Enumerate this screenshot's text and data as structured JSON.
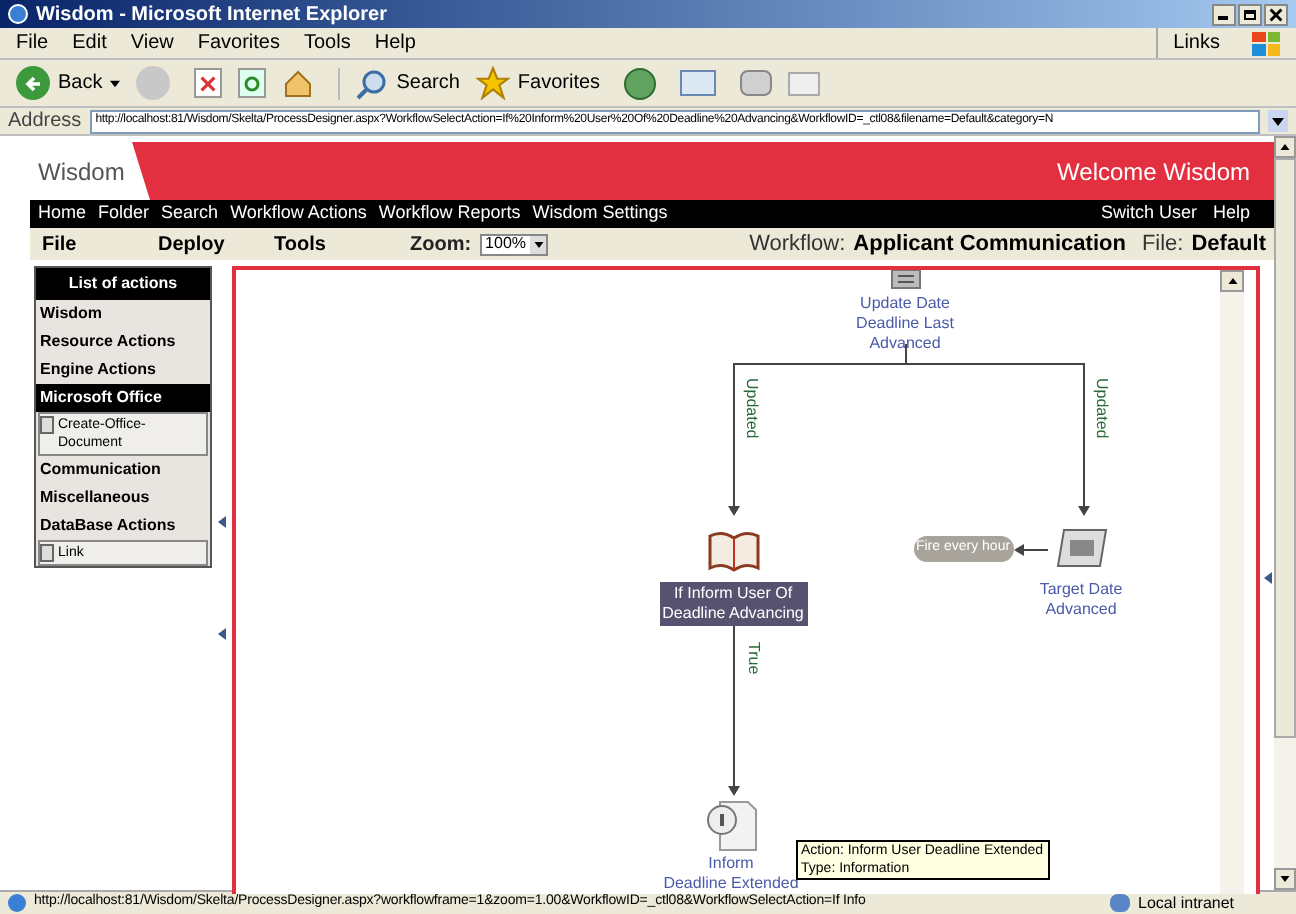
{
  "window": {
    "title": "Wisdom - Microsoft Internet Explorer"
  },
  "menu": [
    "File",
    "Edit",
    "View",
    "Favorites",
    "Tools",
    "Help"
  ],
  "links": "Links",
  "toolbar": {
    "back": "Back",
    "search": "Search",
    "favorites": "Favorites"
  },
  "address": {
    "label": "Address",
    "url": "http://localhost:81/Wisdom/Skelta/ProcessDesigner.aspx?WorkflowSelectAction=If%20Inform%20User%20Of%20Deadline%20Advancing&WorkflowID=_ctl08&filename=Default&category=N"
  },
  "app": {
    "brand": "Wisdom",
    "welcome": "Welcome Wisdom",
    "nav": [
      "Home",
      "Folder",
      "Search",
      "Workflow Actions",
      "Workflow Reports",
      "Wisdom Settings"
    ],
    "nav_right": [
      "Switch User",
      "Help"
    ],
    "menus": [
      "File",
      "Deploy",
      "Tools"
    ],
    "zoom_label": "Zoom:",
    "zoom": "100%",
    "workflow_label": "Workflow:",
    "workflow": "Applicant Communication",
    "file_label": "File:",
    "file": "Default"
  },
  "actions": {
    "title": "List of actions",
    "items": [
      {
        "kind": "category",
        "label": "Wisdom",
        "selected": false
      },
      {
        "kind": "category",
        "label": "Resource Actions",
        "selected": false
      },
      {
        "kind": "category",
        "label": "Engine Actions",
        "selected": false
      },
      {
        "kind": "category",
        "label": "Microsoft Office",
        "selected": true
      },
      {
        "kind": "action",
        "label": "Create-Office-Document"
      },
      {
        "kind": "category",
        "label": "Communication",
        "selected": false
      },
      {
        "kind": "category",
        "label": "Miscellaneous",
        "selected": false
      },
      {
        "kind": "category",
        "label": "DataBase Actions",
        "selected": false
      },
      {
        "kind": "action",
        "label": "Link"
      }
    ]
  },
  "diagram": {
    "nodes": [
      {
        "kind": "document",
        "label": [
          "Update Date",
          "Deadline Last",
          "Advanced"
        ],
        "selected": false
      },
      {
        "kind": "book",
        "label": [
          "If Inform User Of",
          "Deadline Advancing"
        ],
        "selected": true
      },
      {
        "kind": "calendar",
        "label": [
          "Target Date",
          "Advanced"
        ],
        "selected": false
      },
      {
        "kind": "info",
        "label": [
          "Inform",
          "Deadline Extended"
        ],
        "selected": false
      }
    ],
    "trigger": "Fire every hour",
    "edge_labels": [
      "Updated",
      "Updated",
      "True"
    ],
    "tooltip": [
      "Action: Inform User Deadline Extended",
      "Type: Information"
    ]
  },
  "status_bar": {
    "url": "http://localhost:81/Wisdom/Skelta/ProcessDesigner.aspx?workflowframe=1&zoom=1.00&WorkflowID=_ctl08&WorkflowSelectAction=If Info",
    "zone": "Local intranet"
  }
}
